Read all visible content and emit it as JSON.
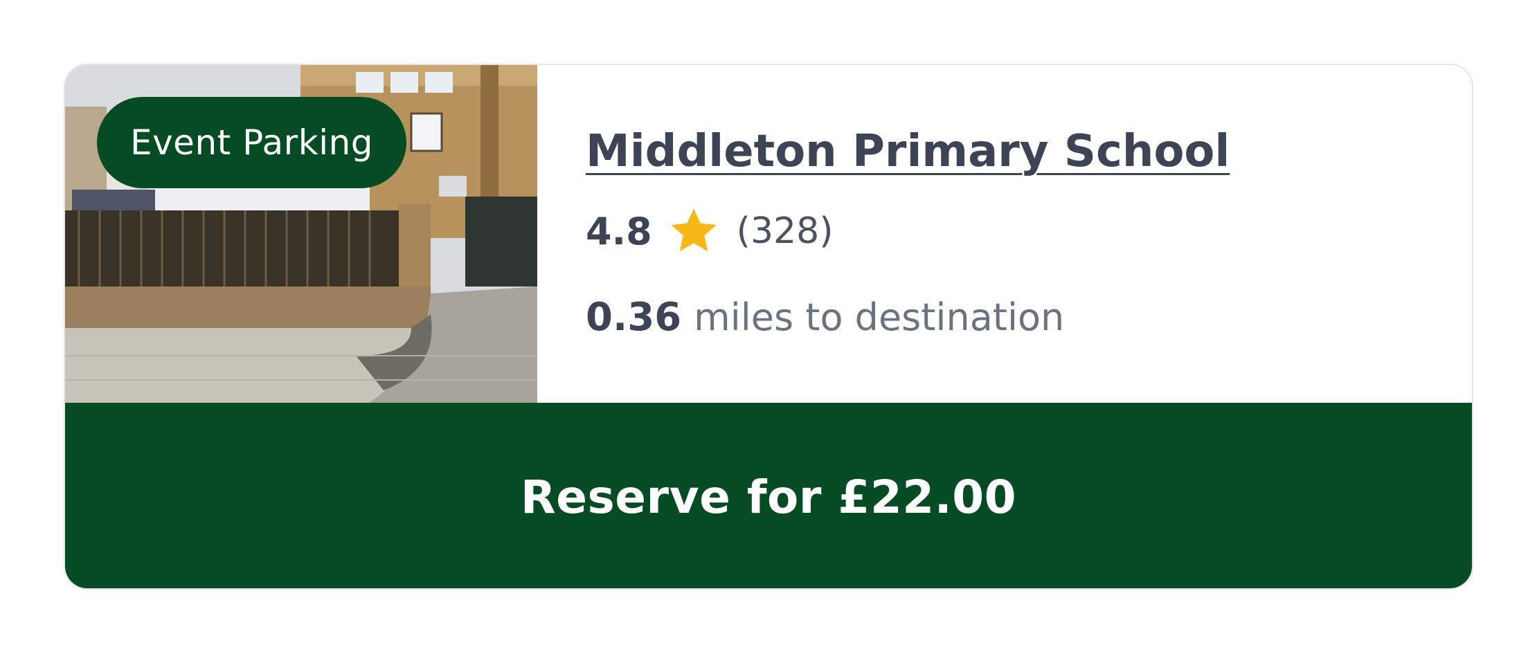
{
  "listing": {
    "badge": "Event Parking",
    "title": "Middleton Primary School",
    "rating": "4.8",
    "review_count": "(328)",
    "distance_value": "0.36",
    "distance_label": "miles to destination",
    "reserve_label": "Reserve for £22.00",
    "star_icon": "star-icon",
    "colors": {
      "brand_green": "#054b24",
      "star": "#f8b818",
      "text_dark": "#3d4456",
      "text_muted": "#6b7280"
    }
  }
}
